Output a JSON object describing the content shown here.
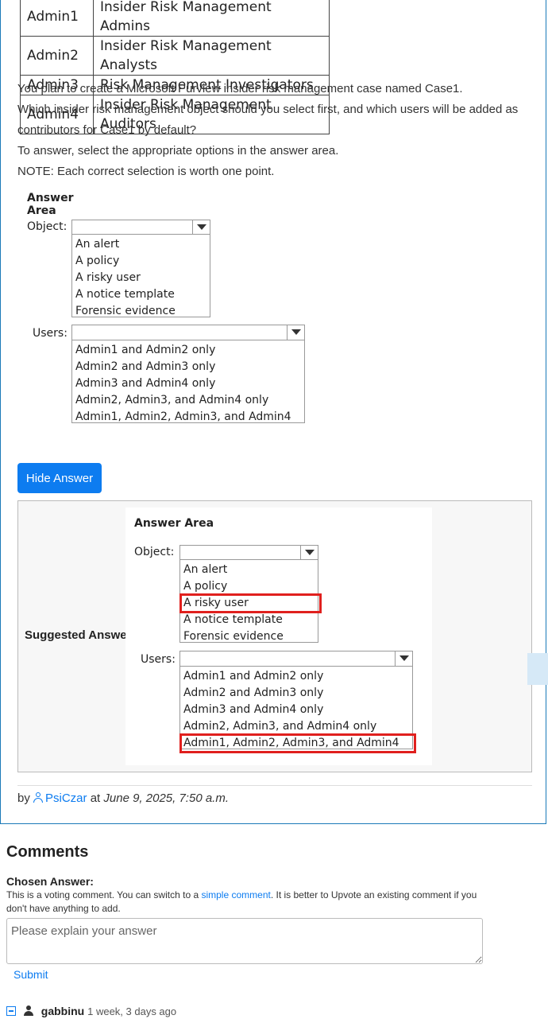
{
  "roles_table": [
    [
      "Admin1",
      "Insider Risk Management Admins"
    ],
    [
      "Admin2",
      "Insider Risk Management Analysts"
    ],
    [
      "Admin3",
      "Risk Management Investigators"
    ],
    [
      "Admin4",
      "Insider Risk Management Auditors"
    ]
  ],
  "question": {
    "line1": "You plan to create a Microsoft Purview insider risk management case named Case1.",
    "line2": "Which insider risk management object should you select first, and which users will be added as",
    "line3": "contributors for Case1 by default?",
    "line4": "To answer, select the appropriate options in the answer area.",
    "line5": "NOTE: Each correct selection is worth one point."
  },
  "answer_area": {
    "title": "Answer Area",
    "object_label": "Object:",
    "object_options": [
      "An alert",
      "A policy",
      "A risky user",
      "A notice template",
      "Forensic evidence"
    ],
    "users_label": "Users:",
    "users_options": [
      "Admin1 and Admin2 only",
      "Admin2 and Admin3 only",
      "Admin3 and Admin4 only",
      "Admin2, Admin3, and Admin4 only",
      "Admin1, Admin2, Admin3, and Admin4"
    ]
  },
  "hide_answer_label": "Hide Answer",
  "suggested": {
    "label": "Suggested Answer:",
    "selected_object": "A risky user",
    "selected_users": "Admin1, Admin2, Admin3, and Admin4",
    "highlight_color": "#e0201e"
  },
  "byline": {
    "prefix": "by",
    "user": "PsiCzar",
    "at": "at",
    "date": "June 9, 2025, 7:50 a.m."
  },
  "comments": {
    "heading": "Comments",
    "chosen_answer_label": "Chosen Answer:",
    "note_part1": "This is a voting comment. You can switch to a",
    "note_link": "simple comment",
    "note_part2": ". It is better to Upvote an existing comment if you don't have anything to add.",
    "placeholder": "Please explain your answer",
    "submit_label": "Submit",
    "first_comment_user": "gabbinu",
    "first_comment_time": "1 week, 3 days ago"
  },
  "colors": {
    "accent": "#0d7cf0",
    "card_border": "#1a7ab8"
  }
}
